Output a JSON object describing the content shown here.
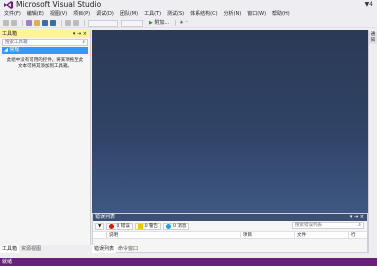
{
  "window": {
    "title": "Microsoft Visual Studio",
    "notification_flag": "▼4"
  },
  "menu": [
    "文件(F)",
    "编辑(E)",
    "视图(V)",
    "项目(P)",
    "调试(D)",
    "团队(M)",
    "工具(T)",
    "测试(S)",
    "体系结构(C)",
    "分析(N)",
    "窗口(W)",
    "帮助(H)"
  ],
  "toolbar": {
    "start_glyph": "▶",
    "start_label": "附加...",
    "extra": "☀ ⁻"
  },
  "toolbox": {
    "title": "工具箱",
    "controls": "▾ ⇥ ×",
    "search_placeholder": "搜索工具箱",
    "search_icon": "⌕",
    "group": "◢ 常规",
    "empty_message": "此组中没有可用的控件。将某项拖至此文本可将其添加到工具箱。"
  },
  "left_tabs": [
    "工具箱",
    "资源视图"
  ],
  "error_list": {
    "title": "错误列表",
    "controls": "▾ ⇥ ×",
    "filter": "▼",
    "errors_label": "0 错误",
    "warnings_label": "0 警告",
    "messages_label": "0 消息",
    "search_placeholder": "搜索错误列表",
    "search_icon": "⌕",
    "columns": [
      "说明",
      "项目",
      "文件",
      "行"
    ]
  },
  "bottom_tabs": [
    "错误列表",
    "命令窗口"
  ],
  "right_tabs": [
    "通知"
  ],
  "status": "就绪",
  "colors": {
    "statusbar": "#68217a",
    "editor": "#2b3a55",
    "highlight": "#fff29d",
    "selection": "#3399ff"
  }
}
